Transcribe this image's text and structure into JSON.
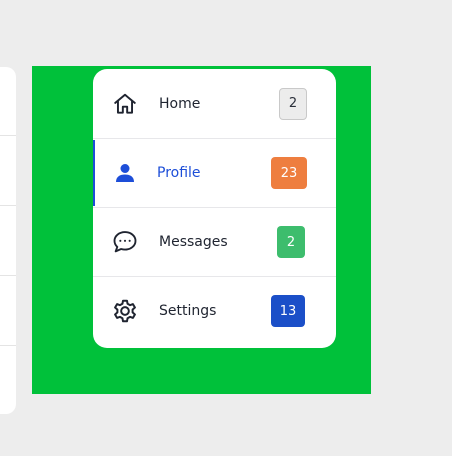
{
  "menu": {
    "items": [
      {
        "label": "Home",
        "badge": "2",
        "icon": "home-icon",
        "active": false
      },
      {
        "label": "Profile",
        "badge": "23",
        "icon": "user-icon",
        "active": true
      },
      {
        "label": "Messages",
        "badge": "2",
        "icon": "chat-bubble-icon",
        "active": false
      },
      {
        "label": "Settings",
        "badge": "13",
        "icon": "gear-icon",
        "active": false
      }
    ]
  },
  "colors": {
    "background": "#ededed",
    "panel_green": "#00c13a",
    "active_blue": "#1d4ed8",
    "badge_orange": "#ee7e3f",
    "badge_green": "#3dbd6d",
    "badge_blue": "#1b4fc8"
  }
}
